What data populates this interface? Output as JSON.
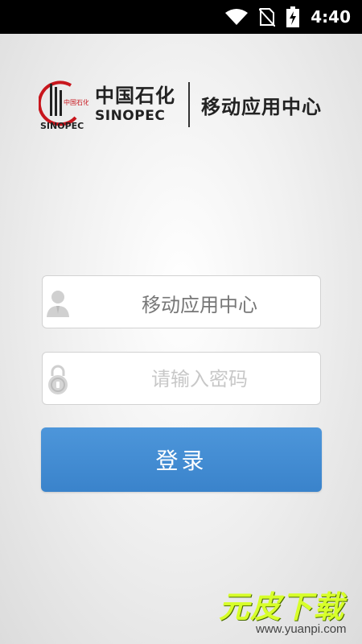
{
  "status_bar": {
    "time": "4:40"
  },
  "brand": {
    "logo_text": "中国石化",
    "logo_en": "SINOPEC",
    "company_cn": "中国石化",
    "company_en": "SINOPEC",
    "app_name": "移动应用中心"
  },
  "login": {
    "username_value": "移动应用中心",
    "password_placeholder": "请输入密码",
    "submit_label": "登录"
  },
  "watermark": {
    "title": "元皮下载",
    "url": "www.yuanpi.com"
  },
  "colors": {
    "button": "#3f89d1",
    "status_bar": "#000000",
    "watermark_green": "#d7ff2a"
  }
}
